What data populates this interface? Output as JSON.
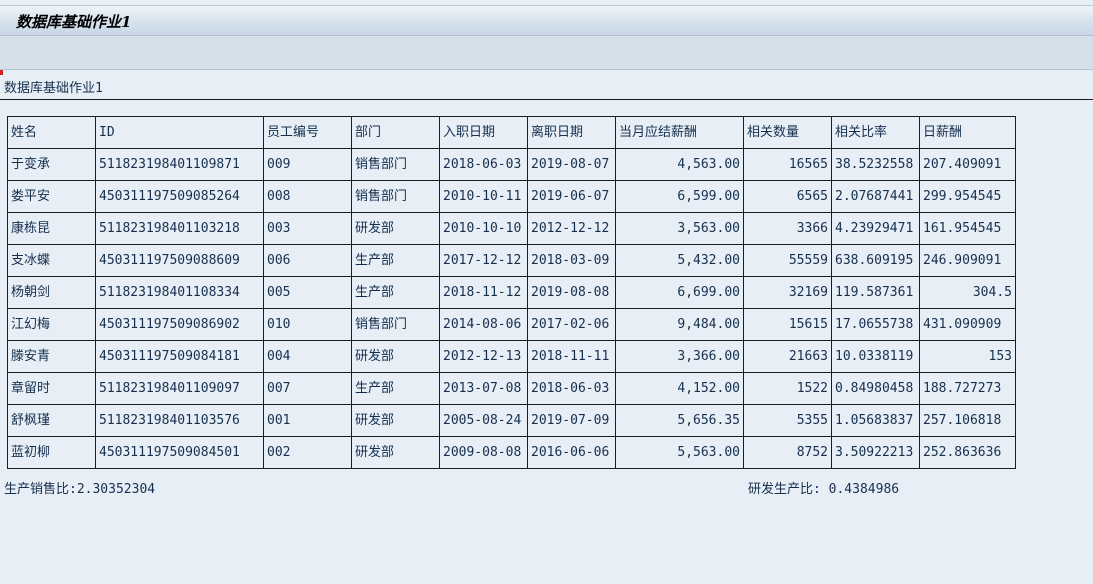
{
  "window": {
    "title": "数据库基础作业1"
  },
  "page": {
    "heading": "数据库基础作业1"
  },
  "table": {
    "headers": [
      "姓名",
      "ID",
      "员工编号",
      "部门",
      "入职日期",
      "离职日期",
      "当月应结薪酬",
      "相关数量",
      "相关比率",
      "日薪酬"
    ],
    "rows": [
      [
        "于变承",
        "511823198401109871",
        "009",
        "销售部门",
        "2018-06-03",
        "2019-08-07",
        "4,563.00",
        "16565",
        "38.5232558",
        "207.409091"
      ],
      [
        "娄平安",
        "450311197509085264",
        "008",
        "销售部门",
        "2010-10-11",
        "2019-06-07",
        "6,599.00",
        "6565",
        "2.07687441",
        "299.954545"
      ],
      [
        "康栋昆",
        "511823198401103218",
        "003",
        "研发部",
        "2010-10-10",
        "2012-12-12",
        "3,563.00",
        "3366",
        "4.23929471",
        "161.954545"
      ],
      [
        "支冰蝶",
        "450311197509088609",
        "006",
        "生产部",
        "2017-12-12",
        "2018-03-09",
        "5,432.00",
        "55559",
        "638.609195",
        "246.909091"
      ],
      [
        "杨朝剑",
        "511823198401108334",
        "005",
        "生产部",
        "2018-11-12",
        "2019-08-08",
        "6,699.00",
        "32169",
        "119.587361",
        "304.5"
      ],
      [
        "江幻梅",
        "450311197509086902",
        "010",
        "销售部门",
        "2014-08-06",
        "2017-02-06",
        "9,484.00",
        "15615",
        "17.0655738",
        "431.090909"
      ],
      [
        "滕安青",
        "450311197509084181",
        "004",
        "研发部",
        "2012-12-13",
        "2018-11-11",
        "3,366.00",
        "21663",
        "10.0338119",
        "153"
      ],
      [
        "章留时",
        "511823198401109097",
        "007",
        "生产部",
        "2013-07-08",
        "2018-06-03",
        "4,152.00",
        "1522",
        "0.84980458",
        "188.727273"
      ],
      [
        "舒枫瑾",
        "511823198401103576",
        "001",
        "研发部",
        "2005-08-24",
        "2019-07-09",
        "5,656.35",
        "5355",
        "1.05683837",
        "257.106818"
      ],
      [
        "蓝初柳",
        "450311197509084501",
        "002",
        "研发部",
        "2009-08-08",
        "2016-06-06",
        "5,563.00",
        "8752",
        "3.50922213",
        "252.863636"
      ]
    ]
  },
  "footer": {
    "left": "生产销售比:2.30352304",
    "right": "研发生产比: 0.4384986"
  }
}
